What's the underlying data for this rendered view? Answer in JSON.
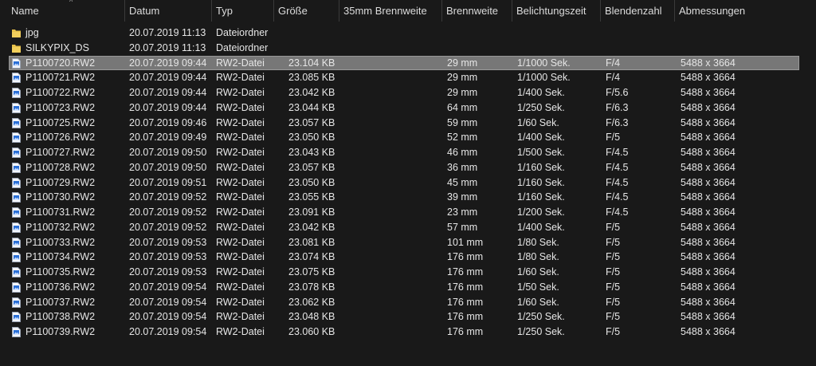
{
  "columns": {
    "name": "Name",
    "date": "Datum",
    "type": "Typ",
    "size": "Größe",
    "focal35": "35mm Brennweite",
    "focal": "Brennweite",
    "exposure": "Belichtungszeit",
    "fnumber": "Blendenzahl",
    "dimensions": "Abmessungen"
  },
  "colors": {
    "background": "#191919",
    "selection": "#777777",
    "folder": "#e8c14a",
    "file_icon": "#2a6fd6"
  },
  "rows": [
    {
      "icon": "folder-icon",
      "name": "jpg",
      "date": "20.07.2019 11:13",
      "type": "Dateiordner",
      "size": "",
      "focal35": "",
      "focal": "",
      "exposure": "",
      "fnumber": "",
      "dimensions": ""
    },
    {
      "icon": "folder-icon",
      "name": "SILKYPIX_DS",
      "date": "20.07.2019 11:13",
      "type": "Dateiordner",
      "size": "",
      "focal35": "",
      "focal": "",
      "exposure": "",
      "fnumber": "",
      "dimensions": ""
    },
    {
      "icon": "raw-file-icon",
      "selected": true,
      "name": "P1100720.RW2",
      "date": "20.07.2019 09:44",
      "type": "RW2-Datei",
      "size": "23.104 KB",
      "focal35": "",
      "focal": "29 mm",
      "exposure": "1/1000 Sek.",
      "fnumber": "F/4",
      "dimensions": "5488 x 3664"
    },
    {
      "icon": "raw-file-icon",
      "name": "P1100721.RW2",
      "date": "20.07.2019 09:44",
      "type": "RW2-Datei",
      "size": "23.085 KB",
      "focal35": "",
      "focal": "29 mm",
      "exposure": "1/1000 Sek.",
      "fnumber": "F/4",
      "dimensions": "5488 x 3664"
    },
    {
      "icon": "raw-file-icon",
      "name": "P1100722.RW2",
      "date": "20.07.2019 09:44",
      "type": "RW2-Datei",
      "size": "23.042 KB",
      "focal35": "",
      "focal": "29 mm",
      "exposure": "1/400 Sek.",
      "fnumber": "F/5.6",
      "dimensions": "5488 x 3664"
    },
    {
      "icon": "raw-file-icon",
      "name": "P1100723.RW2",
      "date": "20.07.2019 09:44",
      "type": "RW2-Datei",
      "size": "23.044 KB",
      "focal35": "",
      "focal": "64 mm",
      "exposure": "1/250 Sek.",
      "fnumber": "F/6.3",
      "dimensions": "5488 x 3664"
    },
    {
      "icon": "raw-file-icon",
      "name": "P1100725.RW2",
      "date": "20.07.2019 09:46",
      "type": "RW2-Datei",
      "size": "23.057 KB",
      "focal35": "",
      "focal": "59 mm",
      "exposure": "1/60 Sek.",
      "fnumber": "F/6.3",
      "dimensions": "5488 x 3664"
    },
    {
      "icon": "raw-file-icon",
      "name": "P1100726.RW2",
      "date": "20.07.2019 09:49",
      "type": "RW2-Datei",
      "size": "23.050 KB",
      "focal35": "",
      "focal": "52 mm",
      "exposure": "1/400 Sek.",
      "fnumber": "F/5",
      "dimensions": "5488 x 3664"
    },
    {
      "icon": "raw-file-icon",
      "name": "P1100727.RW2",
      "date": "20.07.2019 09:50",
      "type": "RW2-Datei",
      "size": "23.043 KB",
      "focal35": "",
      "focal": "46 mm",
      "exposure": "1/500 Sek.",
      "fnumber": "F/4.5",
      "dimensions": "5488 x 3664"
    },
    {
      "icon": "raw-file-icon",
      "name": "P1100728.RW2",
      "date": "20.07.2019 09:50",
      "type": "RW2-Datei",
      "size": "23.057 KB",
      "focal35": "",
      "focal": "36 mm",
      "exposure": "1/160 Sek.",
      "fnumber": "F/4.5",
      "dimensions": "5488 x 3664"
    },
    {
      "icon": "raw-file-icon",
      "name": "P1100729.RW2",
      "date": "20.07.2019 09:51",
      "type": "RW2-Datei",
      "size": "23.050 KB",
      "focal35": "",
      "focal": "45 mm",
      "exposure": "1/160 Sek.",
      "fnumber": "F/4.5",
      "dimensions": "5488 x 3664"
    },
    {
      "icon": "raw-file-icon",
      "name": "P1100730.RW2",
      "date": "20.07.2019 09:52",
      "type": "RW2-Datei",
      "size": "23.055 KB",
      "focal35": "",
      "focal": "39 mm",
      "exposure": "1/160 Sek.",
      "fnumber": "F/4.5",
      "dimensions": "5488 x 3664"
    },
    {
      "icon": "raw-file-icon",
      "name": "P1100731.RW2",
      "date": "20.07.2019 09:52",
      "type": "RW2-Datei",
      "size": "23.091 KB",
      "focal35": "",
      "focal": "23 mm",
      "exposure": "1/200 Sek.",
      "fnumber": "F/4.5",
      "dimensions": "5488 x 3664"
    },
    {
      "icon": "raw-file-icon",
      "name": "P1100732.RW2",
      "date": "20.07.2019 09:52",
      "type": "RW2-Datei",
      "size": "23.042 KB",
      "focal35": "",
      "focal": "57 mm",
      "exposure": "1/400 Sek.",
      "fnumber": "F/5",
      "dimensions": "5488 x 3664"
    },
    {
      "icon": "raw-file-icon",
      "name": "P1100733.RW2",
      "date": "20.07.2019 09:53",
      "type": "RW2-Datei",
      "size": "23.081 KB",
      "focal35": "",
      "focal": "101 mm",
      "exposure": "1/80 Sek.",
      "fnumber": "F/5",
      "dimensions": "5488 x 3664"
    },
    {
      "icon": "raw-file-icon",
      "name": "P1100734.RW2",
      "date": "20.07.2019 09:53",
      "type": "RW2-Datei",
      "size": "23.074 KB",
      "focal35": "",
      "focal": "176 mm",
      "exposure": "1/80 Sek.",
      "fnumber": "F/5",
      "dimensions": "5488 x 3664"
    },
    {
      "icon": "raw-file-icon",
      "name": "P1100735.RW2",
      "date": "20.07.2019 09:53",
      "type": "RW2-Datei",
      "size": "23.075 KB",
      "focal35": "",
      "focal": "176 mm",
      "exposure": "1/60 Sek.",
      "fnumber": "F/5",
      "dimensions": "5488 x 3664"
    },
    {
      "icon": "raw-file-icon",
      "name": "P1100736.RW2",
      "date": "20.07.2019 09:54",
      "type": "RW2-Datei",
      "size": "23.078 KB",
      "focal35": "",
      "focal": "176 mm",
      "exposure": "1/50 Sek.",
      "fnumber": "F/5",
      "dimensions": "5488 x 3664"
    },
    {
      "icon": "raw-file-icon",
      "name": "P1100737.RW2",
      "date": "20.07.2019 09:54",
      "type": "RW2-Datei",
      "size": "23.062 KB",
      "focal35": "",
      "focal": "176 mm",
      "exposure": "1/60 Sek.",
      "fnumber": "F/5",
      "dimensions": "5488 x 3664"
    },
    {
      "icon": "raw-file-icon",
      "name": "P1100738.RW2",
      "date": "20.07.2019 09:54",
      "type": "RW2-Datei",
      "size": "23.048 KB",
      "focal35": "",
      "focal": "176 mm",
      "exposure": "1/250 Sek.",
      "fnumber": "F/5",
      "dimensions": "5488 x 3664"
    },
    {
      "icon": "raw-file-icon",
      "name": "P1100739.RW2",
      "date": "20.07.2019 09:54",
      "type": "RW2-Datei",
      "size": "23.060 KB",
      "focal35": "",
      "focal": "176 mm",
      "exposure": "1/250 Sek.",
      "fnumber": "F/5",
      "dimensions": "5488 x 3664"
    }
  ]
}
